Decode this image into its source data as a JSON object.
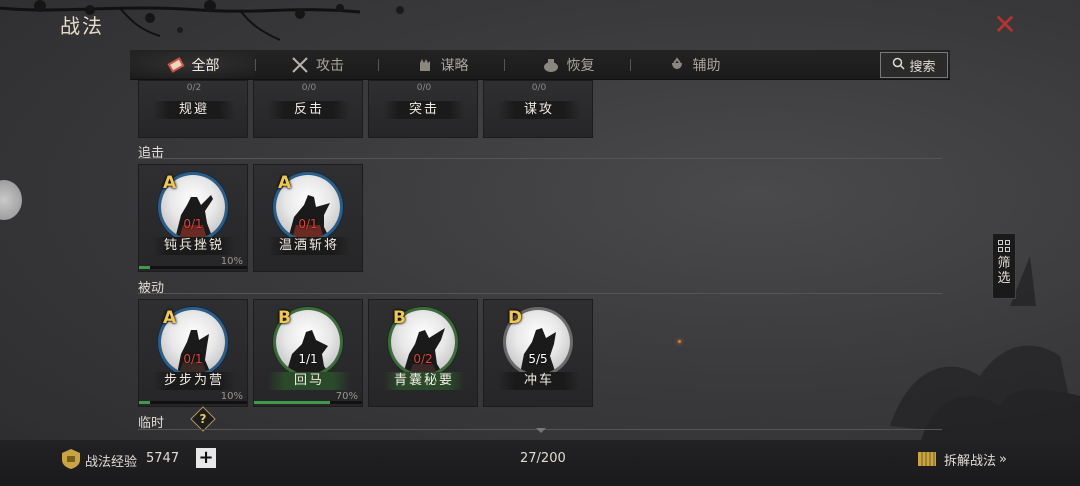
{
  "header": {
    "title": "战法",
    "close_symbol": "✕"
  },
  "tabs": [
    {
      "label": "全部",
      "icon": "scroll-icon",
      "active": true
    },
    {
      "label": "攻击",
      "icon": "crossed-swords-icon",
      "active": false
    },
    {
      "label": "谋略",
      "icon": "hand-icon",
      "active": false
    },
    {
      "label": "恢复",
      "icon": "pot-icon",
      "active": false
    },
    {
      "label": "辅助",
      "icon": "pouch-icon",
      "active": false
    }
  ],
  "search": {
    "label": "搜索",
    "icon": "magnifier-icon"
  },
  "top_partial_row": [
    {
      "name": "规避",
      "stub": "0/2"
    },
    {
      "name": "反击",
      "stub": "0/0"
    },
    {
      "name": "突击",
      "stub": "0/0"
    },
    {
      "name": "谋攻",
      "stub": "0/0"
    }
  ],
  "sections": [
    {
      "label": "追击",
      "cards": [
        {
          "grade": "A",
          "count": "0/1",
          "count_color": "red",
          "name": "钝兵挫锐",
          "percent": "10%",
          "progress": 0.1,
          "ring": "A"
        },
        {
          "grade": "A",
          "count": "0/1",
          "count_color": "red",
          "name": "温酒斩将",
          "percent": "",
          "progress": null,
          "ring": "A"
        }
      ]
    },
    {
      "label": "被动",
      "cards": [
        {
          "grade": "A",
          "count": "0/1",
          "count_color": "red",
          "name": "步步为营",
          "percent": "10%",
          "progress": 0.1,
          "ring": "A"
        },
        {
          "grade": "B",
          "count": "1/1",
          "count_color": "white",
          "name": "回马",
          "percent": "70%",
          "progress": 0.7,
          "ring": "B"
        },
        {
          "grade": "B",
          "count": "0/2",
          "count_color": "red",
          "name": "青囊秘要",
          "percent": "",
          "progress": null,
          "ring": "B"
        },
        {
          "grade": "D",
          "count": "5/5",
          "count_color": "white",
          "name": "冲车",
          "percent": "",
          "progress": null,
          "ring": "D"
        }
      ]
    },
    {
      "label": "临时",
      "cards": []
    }
  ],
  "help_symbol": "?",
  "filter": {
    "label": "筛选"
  },
  "footer": {
    "exp_label": "战法经验",
    "exp_value": "5747",
    "plus_label": "+",
    "count": "27/200",
    "dismantle_label": "拆解战法",
    "dismantle_arrow": "»"
  }
}
